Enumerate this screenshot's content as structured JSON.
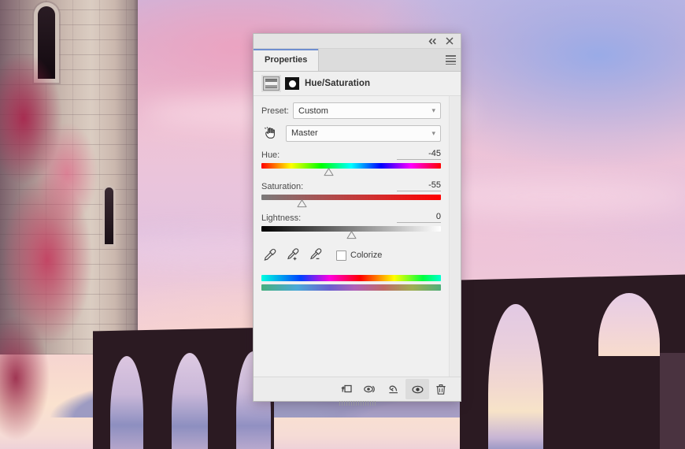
{
  "app": {
    "panel_title": "Properties",
    "adjustment_name": "Hue/Saturation"
  },
  "titlebar": {
    "collapse_icon": "double-chevron-left-icon",
    "close_icon": "close-icon",
    "menu_icon": "panel-menu-icon"
  },
  "adjustment": {
    "type_icon": "hue-saturation-adjustment-icon",
    "mask_icon": "layer-mask-thumbnail-icon",
    "targeted_tool_icon": "on-image-adjustment-hand-icon"
  },
  "preset": {
    "label": "Preset:",
    "value": "Custom",
    "chevron": "chevron-down-icon"
  },
  "channel": {
    "value": "Master",
    "chevron": "chevron-down-icon"
  },
  "sliders": [
    {
      "name": "Hue:",
      "value": "-45",
      "numeric": -45,
      "min": -180,
      "max": 180,
      "percent": 37.5,
      "track": "hue"
    },
    {
      "name": "Saturation:",
      "value": "-55",
      "numeric": -55,
      "min": -100,
      "max": 100,
      "percent": 22.5,
      "track": "sat"
    },
    {
      "name": "Lightness:",
      "value": "0",
      "numeric": 0,
      "min": -100,
      "max": 100,
      "percent": 50,
      "track": "light"
    }
  ],
  "eyedroppers": [
    {
      "icon": "eyedropper-icon",
      "name": "sample-color"
    },
    {
      "icon": "eyedropper-add-icon",
      "name": "add-to-sample"
    },
    {
      "icon": "eyedropper-subtract-icon",
      "name": "subtract-from-sample"
    }
  ],
  "colorize": {
    "label": "Colorize",
    "checked": false
  },
  "spectrum_bars": {
    "input_bar": "input-hue-spectrum",
    "output_bar": "output-hue-spectrum"
  },
  "footer_buttons": [
    {
      "icon": "clip-to-layer-icon",
      "name": "clip-to-layer-button",
      "active": false
    },
    {
      "icon": "view-previous-state-icon",
      "name": "view-previous-state-button",
      "active": false
    },
    {
      "icon": "reset-icon",
      "name": "reset-adjustment-button",
      "active": false
    },
    {
      "icon": "eye-icon",
      "name": "toggle-layer-visibility-button",
      "active": true
    },
    {
      "icon": "trash-icon",
      "name": "delete-adjustment-layer-button",
      "active": false
    }
  ],
  "colors": {
    "panel_bg": "#f0f0f0",
    "panel_border": "#b9b9b9",
    "tab_accent": "#6f8fd0",
    "text": "#3c3c3c",
    "sky_pink": "#eec3d6",
    "sky_blue": "#96aae8",
    "ivy_pink": "#c43e60",
    "stone": "#cdbcb2",
    "viaduct_dark": "#2b1a22"
  },
  "background_scene": {
    "description": "sunset-sky-with-castle-tower-and-viaduct",
    "elements": [
      "sky",
      "distant-hills",
      "ivy-covered-tower",
      "left-viaduct-arches",
      "right-viaduct-arches"
    ]
  }
}
